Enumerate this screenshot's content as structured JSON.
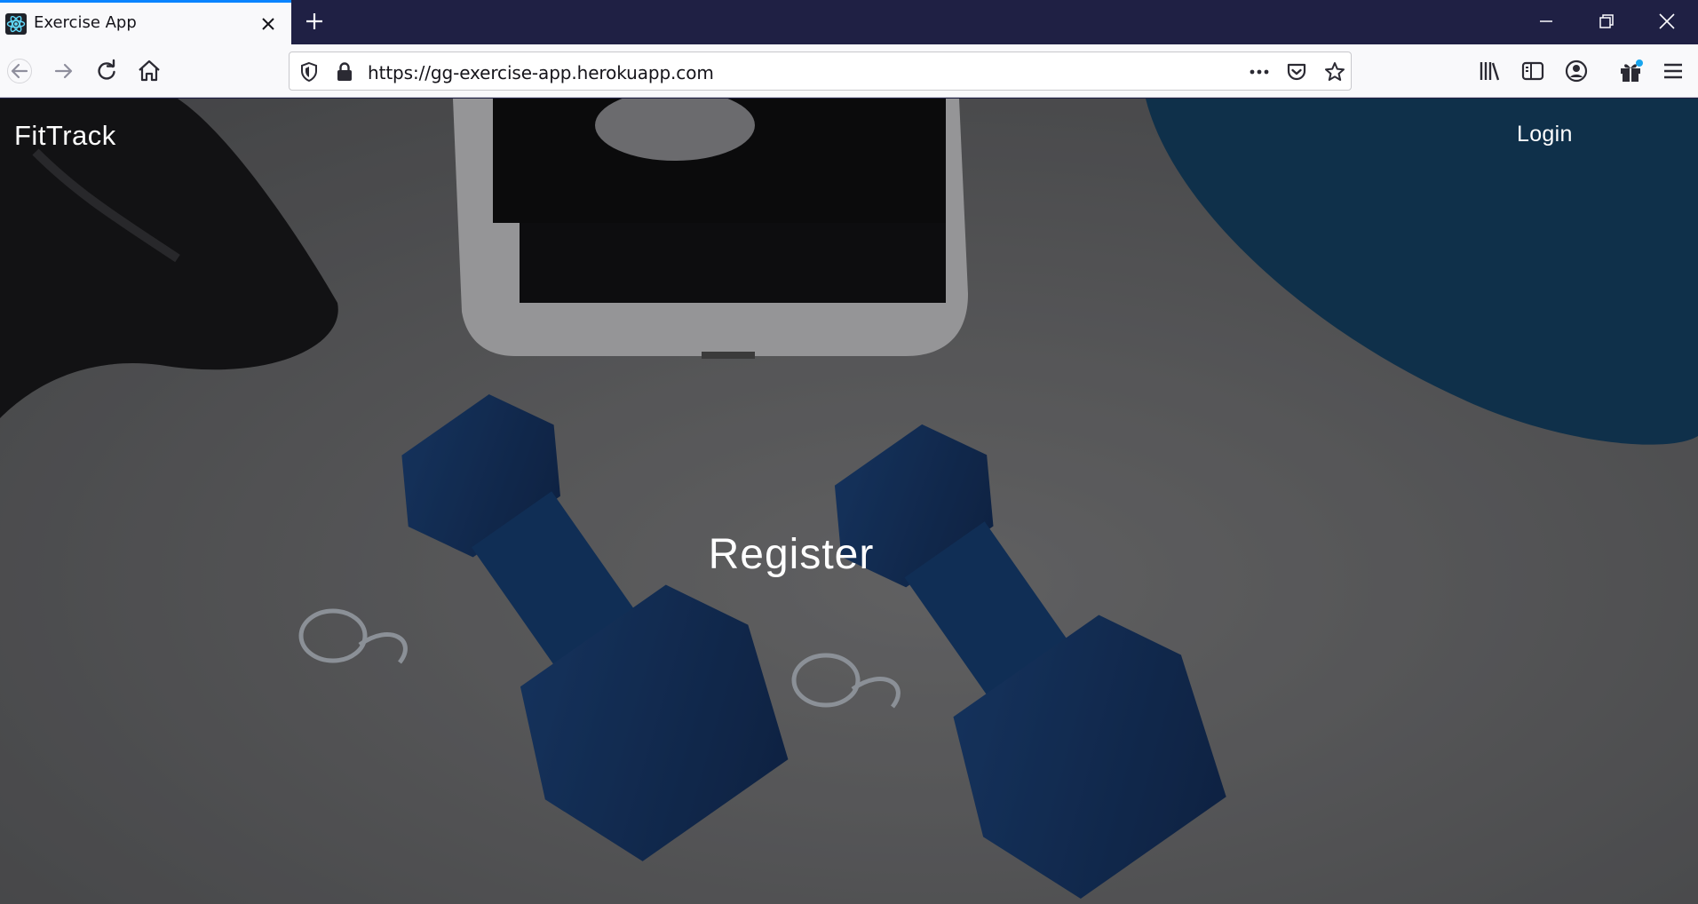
{
  "browser": {
    "tab": {
      "title": "Exercise App",
      "icon": "react-icon"
    },
    "url": "https://gg-exercise-app.herokuapp.com",
    "colors": {
      "tab_strip": "#1f2044",
      "tab_accent": "#0a84ff",
      "toolbar": "#f9f9fb",
      "badge": "#18a5ee"
    }
  },
  "app": {
    "brand": "FitTrack",
    "nav": {
      "login_label": "Login"
    },
    "hero": {
      "title": "Register"
    }
  }
}
